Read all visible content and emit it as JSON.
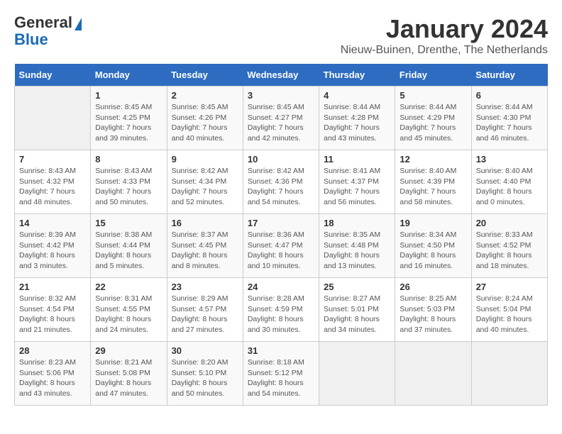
{
  "header": {
    "logo_general": "General",
    "logo_blue": "Blue",
    "month_title": "January 2024",
    "location": "Nieuw-Buinen, Drenthe, The Netherlands"
  },
  "days_of_week": [
    "Sunday",
    "Monday",
    "Tuesday",
    "Wednesday",
    "Thursday",
    "Friday",
    "Saturday"
  ],
  "weeks": [
    [
      {
        "day": "",
        "sunrise": "",
        "sunset": "",
        "daylight": ""
      },
      {
        "day": "1",
        "sunrise": "Sunrise: 8:45 AM",
        "sunset": "Sunset: 4:25 PM",
        "daylight": "Daylight: 7 hours and 39 minutes."
      },
      {
        "day": "2",
        "sunrise": "Sunrise: 8:45 AM",
        "sunset": "Sunset: 4:26 PM",
        "daylight": "Daylight: 7 hours and 40 minutes."
      },
      {
        "day": "3",
        "sunrise": "Sunrise: 8:45 AM",
        "sunset": "Sunset: 4:27 PM",
        "daylight": "Daylight: 7 hours and 42 minutes."
      },
      {
        "day": "4",
        "sunrise": "Sunrise: 8:44 AM",
        "sunset": "Sunset: 4:28 PM",
        "daylight": "Daylight: 7 hours and 43 minutes."
      },
      {
        "day": "5",
        "sunrise": "Sunrise: 8:44 AM",
        "sunset": "Sunset: 4:29 PM",
        "daylight": "Daylight: 7 hours and 45 minutes."
      },
      {
        "day": "6",
        "sunrise": "Sunrise: 8:44 AM",
        "sunset": "Sunset: 4:30 PM",
        "daylight": "Daylight: 7 hours and 46 minutes."
      }
    ],
    [
      {
        "day": "7",
        "sunrise": "Sunrise: 8:43 AM",
        "sunset": "Sunset: 4:32 PM",
        "daylight": "Daylight: 7 hours and 48 minutes."
      },
      {
        "day": "8",
        "sunrise": "Sunrise: 8:43 AM",
        "sunset": "Sunset: 4:33 PM",
        "daylight": "Daylight: 7 hours and 50 minutes."
      },
      {
        "day": "9",
        "sunrise": "Sunrise: 8:42 AM",
        "sunset": "Sunset: 4:34 PM",
        "daylight": "Daylight: 7 hours and 52 minutes."
      },
      {
        "day": "10",
        "sunrise": "Sunrise: 8:42 AM",
        "sunset": "Sunset: 4:36 PM",
        "daylight": "Daylight: 7 hours and 54 minutes."
      },
      {
        "day": "11",
        "sunrise": "Sunrise: 8:41 AM",
        "sunset": "Sunset: 4:37 PM",
        "daylight": "Daylight: 7 hours and 56 minutes."
      },
      {
        "day": "12",
        "sunrise": "Sunrise: 8:40 AM",
        "sunset": "Sunset: 4:39 PM",
        "daylight": "Daylight: 7 hours and 58 minutes."
      },
      {
        "day": "13",
        "sunrise": "Sunrise: 8:40 AM",
        "sunset": "Sunset: 4:40 PM",
        "daylight": "Daylight: 8 hours and 0 minutes."
      }
    ],
    [
      {
        "day": "14",
        "sunrise": "Sunrise: 8:39 AM",
        "sunset": "Sunset: 4:42 PM",
        "daylight": "Daylight: 8 hours and 3 minutes."
      },
      {
        "day": "15",
        "sunrise": "Sunrise: 8:38 AM",
        "sunset": "Sunset: 4:44 PM",
        "daylight": "Daylight: 8 hours and 5 minutes."
      },
      {
        "day": "16",
        "sunrise": "Sunrise: 8:37 AM",
        "sunset": "Sunset: 4:45 PM",
        "daylight": "Daylight: 8 hours and 8 minutes."
      },
      {
        "day": "17",
        "sunrise": "Sunrise: 8:36 AM",
        "sunset": "Sunset: 4:47 PM",
        "daylight": "Daylight: 8 hours and 10 minutes."
      },
      {
        "day": "18",
        "sunrise": "Sunrise: 8:35 AM",
        "sunset": "Sunset: 4:48 PM",
        "daylight": "Daylight: 8 hours and 13 minutes."
      },
      {
        "day": "19",
        "sunrise": "Sunrise: 8:34 AM",
        "sunset": "Sunset: 4:50 PM",
        "daylight": "Daylight: 8 hours and 16 minutes."
      },
      {
        "day": "20",
        "sunrise": "Sunrise: 8:33 AM",
        "sunset": "Sunset: 4:52 PM",
        "daylight": "Daylight: 8 hours and 18 minutes."
      }
    ],
    [
      {
        "day": "21",
        "sunrise": "Sunrise: 8:32 AM",
        "sunset": "Sunset: 4:54 PM",
        "daylight": "Daylight: 8 hours and 21 minutes."
      },
      {
        "day": "22",
        "sunrise": "Sunrise: 8:31 AM",
        "sunset": "Sunset: 4:55 PM",
        "daylight": "Daylight: 8 hours and 24 minutes."
      },
      {
        "day": "23",
        "sunrise": "Sunrise: 8:29 AM",
        "sunset": "Sunset: 4:57 PM",
        "daylight": "Daylight: 8 hours and 27 minutes."
      },
      {
        "day": "24",
        "sunrise": "Sunrise: 8:28 AM",
        "sunset": "Sunset: 4:59 PM",
        "daylight": "Daylight: 8 hours and 30 minutes."
      },
      {
        "day": "25",
        "sunrise": "Sunrise: 8:27 AM",
        "sunset": "Sunset: 5:01 PM",
        "daylight": "Daylight: 8 hours and 34 minutes."
      },
      {
        "day": "26",
        "sunrise": "Sunrise: 8:25 AM",
        "sunset": "Sunset: 5:03 PM",
        "daylight": "Daylight: 8 hours and 37 minutes."
      },
      {
        "day": "27",
        "sunrise": "Sunrise: 8:24 AM",
        "sunset": "Sunset: 5:04 PM",
        "daylight": "Daylight: 8 hours and 40 minutes."
      }
    ],
    [
      {
        "day": "28",
        "sunrise": "Sunrise: 8:23 AM",
        "sunset": "Sunset: 5:06 PM",
        "daylight": "Daylight: 8 hours and 43 minutes."
      },
      {
        "day": "29",
        "sunrise": "Sunrise: 8:21 AM",
        "sunset": "Sunset: 5:08 PM",
        "daylight": "Daylight: 8 hours and 47 minutes."
      },
      {
        "day": "30",
        "sunrise": "Sunrise: 8:20 AM",
        "sunset": "Sunset: 5:10 PM",
        "daylight": "Daylight: 8 hours and 50 minutes."
      },
      {
        "day": "31",
        "sunrise": "Sunrise: 8:18 AM",
        "sunset": "Sunset: 5:12 PM",
        "daylight": "Daylight: 8 hours and 54 minutes."
      },
      {
        "day": "",
        "sunrise": "",
        "sunset": "",
        "daylight": ""
      },
      {
        "day": "",
        "sunrise": "",
        "sunset": "",
        "daylight": ""
      },
      {
        "day": "",
        "sunrise": "",
        "sunset": "",
        "daylight": ""
      }
    ]
  ]
}
